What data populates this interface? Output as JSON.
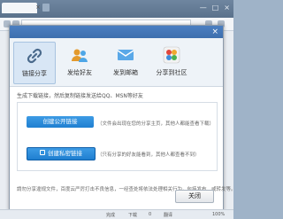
{
  "window": {
    "tab_close": "×",
    "controls": [
      "—",
      "□",
      "×"
    ]
  },
  "dialog": {
    "close_glyph": "×",
    "nav": [
      {
        "label": "链接分享",
        "icon": "link-icon",
        "active": true
      },
      {
        "label": "发给好友",
        "icon": "friends-icon",
        "active": false
      },
      {
        "label": "发到邮箱",
        "icon": "mail-icon",
        "active": false
      },
      {
        "label": "分享到社区",
        "icon": "community-icon",
        "active": false
      }
    ],
    "description": "生成下载链接，然后复制链接发送给QQ、MSN等好友",
    "public_link_button": "创建公开链接",
    "public_link_desc": "（文件会出现在您的分享主页，其他人都能查看下载）",
    "private_link_button": "创建私密链接",
    "private_link_desc": "（只有分享的好友能看到，其他人都查看不到）",
    "footnote": "請勿分享違规文件，百度云严厉打击不良信息，一经查处将依法处理相关行为，包括发布、或转发等。",
    "close_button": "关闭"
  },
  "statusbar": {
    "items": [
      "完成",
      "下载",
      "0",
      "翻译",
      "100%"
    ]
  },
  "colors": {
    "accent": "#1f7fd0",
    "title_bar": "#3e6fae"
  }
}
